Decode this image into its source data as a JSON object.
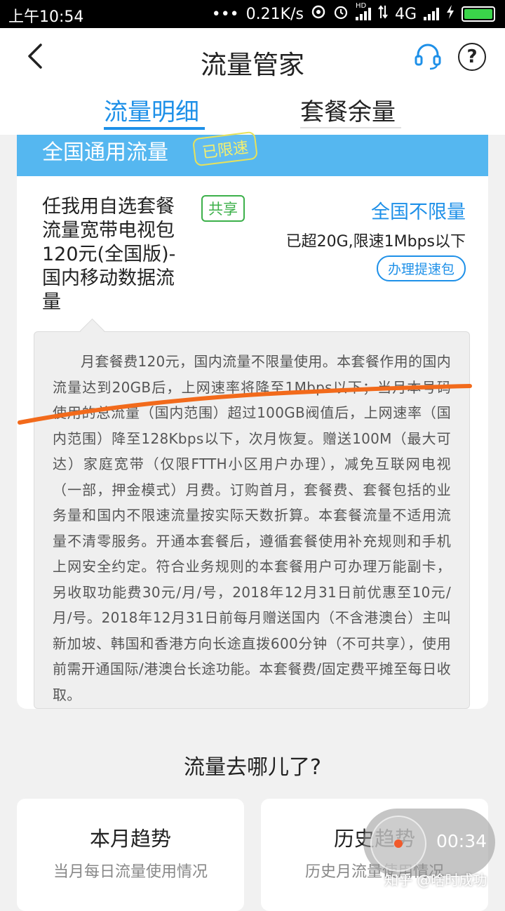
{
  "status_bar": {
    "time": "上午10:54",
    "dots": "•••",
    "net_speed": "0.21K/s",
    "net_type": "4G",
    "hd_label": "HD",
    "battery_color": "#3ad44a"
  },
  "header": {
    "title": "流量管家",
    "help_label": "?",
    "tabs": [
      {
        "label": "流量明细",
        "active": true
      },
      {
        "label": "套餐余量",
        "active": false
      }
    ]
  },
  "card": {
    "head_title": "全国通用流量",
    "head_badge": "已限速",
    "plan_name": "任我用自选套餐流量宽带电视包120元(全国版)-国内移动数据流量",
    "share_badge": "共享",
    "unlimited_label": "全国不限量",
    "limit_note": "已超20G,限速1Mbps以下",
    "speedup_button": "办理提速包",
    "description": "月套餐费120元，国内流量不限量使用。本套餐作用的国内流量达到20GB后，上网速率将降至1Mbps以下；当月本号码使用的总流量（国内范围）超过100GB阀值后，上网速率（国内范围）降至128Kbps以下，次月恢复。赠送100M（最大可达）家庭宽带（仅限FTTH小区用户办理），减免互联网电视（一部，押金模式）月费。订购首月，套餐费、套餐包括的业务量和国内不限速流量按实际天数折算。本套餐流量不适用流量不清零服务。开通本套餐后，遵循套餐使用补充规则和手机上网安全约定。符合业务规则的本套餐用户可办理万能副卡，另收取功能费30元/月/号，2018年12月31日前优惠至10元/月/号。2018年12月31日前每月赠送国内（不含港澳台）主叫新加坡、韩国和香港方向长途直拨600分钟（不可共享），使用前需开通国际/港澳台长途功能。本套餐费/固定费平摊至每日收取。"
  },
  "section": {
    "title": "流量去哪儿了?",
    "tiles": [
      {
        "title": "本月趋势",
        "subtitle": "当月每日流量使用情况"
      },
      {
        "title": "历史趋势",
        "subtitle": "历史月流量使用情况"
      }
    ]
  },
  "overlay": {
    "timer": "00:34",
    "watermark": "知乎 @啥时成功"
  },
  "colors": {
    "accent": "#1e90e8",
    "card_header": "#55b7f0",
    "share_green": "#3cb04a",
    "annotation_orange": "#f26a1b"
  }
}
